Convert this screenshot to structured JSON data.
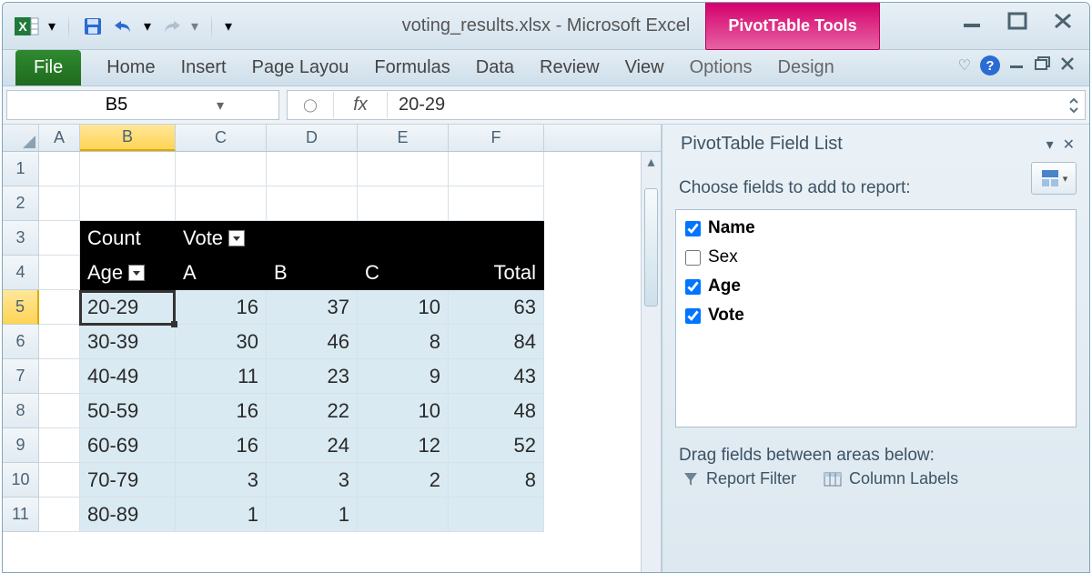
{
  "title": "voting_results.xlsx - Microsoft Excel",
  "context_tab": "PivotTable Tools",
  "ribbon": {
    "file": "File",
    "tabs": [
      "Home",
      "Insert",
      "Page Layou",
      "Formulas",
      "Data",
      "Review",
      "View"
    ],
    "ctx_tabs": [
      "Options",
      "Design"
    ]
  },
  "namebox": "B5",
  "formula": "20-29",
  "columns": [
    "A",
    "B",
    "C",
    "D",
    "E",
    "F"
  ],
  "pivot": {
    "count_label": "Count",
    "vote_label": "Vote",
    "age_label": "Age",
    "col_A": "A",
    "col_B": "B",
    "col_C": "C",
    "col_total": "Total",
    "rows": [
      {
        "age": "20-29",
        "A": 16,
        "B": 37,
        "C": 10,
        "T": 63
      },
      {
        "age": "30-39",
        "A": 30,
        "B": 46,
        "C": 8,
        "T": 84
      },
      {
        "age": "40-49",
        "A": 11,
        "B": 23,
        "C": 9,
        "T": 43
      },
      {
        "age": "50-59",
        "A": 16,
        "B": 22,
        "C": 10,
        "T": 48
      },
      {
        "age": "60-69",
        "A": 16,
        "B": 24,
        "C": 12,
        "T": 52
      },
      {
        "age": "70-79",
        "A": 3,
        "B": 3,
        "C": 2,
        "T": 8
      },
      {
        "age": "80-89",
        "A": 1,
        "B": 1,
        "C": "",
        "T": ""
      }
    ]
  },
  "fieldlist": {
    "title": "PivotTable Field List",
    "prompt": "Choose fields to add to report:",
    "fields": [
      {
        "name": "Name",
        "checked": true
      },
      {
        "name": "Sex",
        "checked": false
      },
      {
        "name": "Age",
        "checked": true
      },
      {
        "name": "Vote",
        "checked": true
      }
    ],
    "drag_prompt": "Drag fields between areas below:",
    "area_filter": "Report Filter",
    "area_columns": "Column Labels"
  }
}
